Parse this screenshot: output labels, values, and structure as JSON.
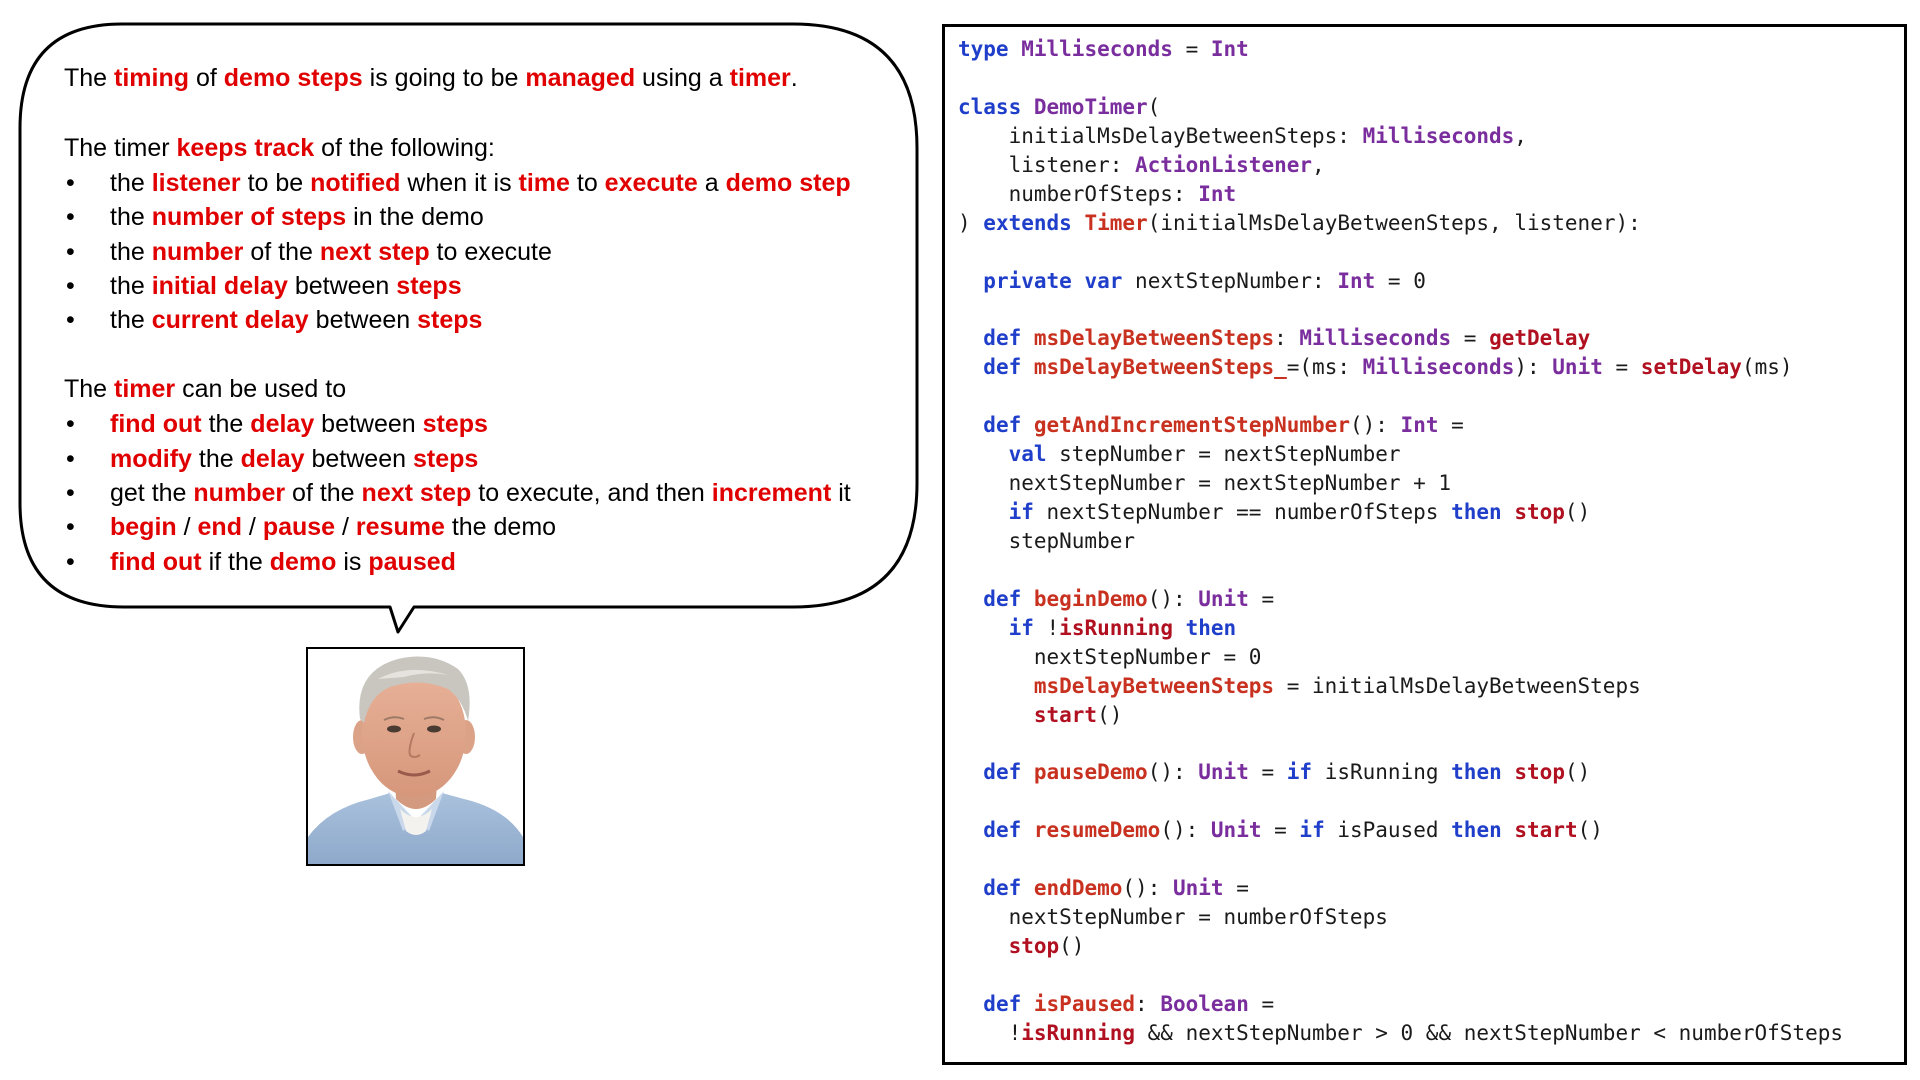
{
  "colors": {
    "highlight": "#e00000",
    "keyword": "#1f3ec9",
    "type": "#7a2e9e",
    "function": "#c8311f",
    "call": "#b01020",
    "text": "#000000"
  },
  "bubble": {
    "paragraphs": [
      {
        "kind": "line",
        "segments": [
          {
            "t": "The "
          },
          {
            "t": "timing",
            "h": true
          },
          {
            "t": " of "
          },
          {
            "t": "demo steps",
            "h": true
          },
          {
            "t": " is going to be "
          },
          {
            "t": "managed",
            "h": true
          },
          {
            "t": " using a "
          },
          {
            "t": "timer",
            "h": true
          },
          {
            "t": "."
          }
        ]
      },
      {
        "kind": "gap"
      },
      {
        "kind": "line",
        "segments": [
          {
            "t": "The timer "
          },
          {
            "t": "keeps track",
            "h": true
          },
          {
            "t": " of the following:"
          }
        ]
      },
      {
        "kind": "bullets",
        "items": [
          [
            {
              "t": "the "
            },
            {
              "t": "listener",
              "h": true
            },
            {
              "t": " to be "
            },
            {
              "t": "notified",
              "h": true
            },
            {
              "t": " when it is "
            },
            {
              "t": "time",
              "h": true
            },
            {
              "t": " to "
            },
            {
              "t": "execute",
              "h": true
            },
            {
              "t": " a "
            },
            {
              "t": "demo step",
              "h": true
            }
          ],
          [
            {
              "t": "the "
            },
            {
              "t": "number of steps",
              "h": true
            },
            {
              "t": " in the demo"
            }
          ],
          [
            {
              "t": "the "
            },
            {
              "t": "number",
              "h": true
            },
            {
              "t": " of the "
            },
            {
              "t": "next step",
              "h": true
            },
            {
              "t": " to execute"
            }
          ],
          [
            {
              "t": "the "
            },
            {
              "t": "initial delay",
              "h": true
            },
            {
              "t": " between "
            },
            {
              "t": "steps",
              "h": true
            }
          ],
          [
            {
              "t": "the "
            },
            {
              "t": "current delay",
              "h": true
            },
            {
              "t": " between "
            },
            {
              "t": "steps",
              "h": true
            }
          ]
        ]
      },
      {
        "kind": "gap"
      },
      {
        "kind": "line",
        "segments": [
          {
            "t": "The "
          },
          {
            "t": "timer",
            "h": true
          },
          {
            "t": " can be used to"
          }
        ]
      },
      {
        "kind": "bullets",
        "items": [
          [
            {
              "t": "find out",
              "h": true
            },
            {
              "t": " the "
            },
            {
              "t": "delay",
              "h": true
            },
            {
              "t": " between "
            },
            {
              "t": "steps",
              "h": true
            }
          ],
          [
            {
              "t": "modify",
              "h": true
            },
            {
              "t": " the "
            },
            {
              "t": "delay",
              "h": true
            },
            {
              "t": " between "
            },
            {
              "t": "steps",
              "h": true
            }
          ],
          [
            {
              "t": "get the "
            },
            {
              "t": "number",
              "h": true
            },
            {
              "t": " of the "
            },
            {
              "t": "next step",
              "h": true
            },
            {
              "t": " to execute, and then "
            },
            {
              "t": "increment",
              "h": true
            },
            {
              "t": " it"
            }
          ],
          [
            {
              "t": "begin",
              "h": true
            },
            {
              "t": " / "
            },
            {
              "t": "end",
              "h": true
            },
            {
              "t": " / "
            },
            {
              "t": "pause",
              "h": true
            },
            {
              "t": " / "
            },
            {
              "t": "resume",
              "h": true
            },
            {
              "t": " the demo"
            }
          ],
          [
            {
              "t": "find out",
              "h": true
            },
            {
              "t": " if the "
            },
            {
              "t": "demo",
              "h": true
            },
            {
              "t": " is "
            },
            {
              "t": "paused",
              "h": true
            }
          ]
        ]
      }
    ]
  },
  "code": [
    [
      [
        "kw",
        "type"
      ],
      [
        "p",
        " "
      ],
      [
        "ty",
        "Milliseconds"
      ],
      [
        "p",
        " = "
      ],
      [
        "ty",
        "Int"
      ]
    ],
    [],
    [
      [
        "kw",
        "class"
      ],
      [
        "p",
        " "
      ],
      [
        "ty",
        "DemoTimer"
      ],
      [
        "p",
        "("
      ]
    ],
    [
      [
        "p",
        "    initialMsDelayBetweenSteps: "
      ],
      [
        "ty",
        "Milliseconds"
      ],
      [
        "p",
        ","
      ]
    ],
    [
      [
        "p",
        "    listener: "
      ],
      [
        "ty",
        "ActionListener"
      ],
      [
        "p",
        ","
      ]
    ],
    [
      [
        "p",
        "    numberOfSteps: "
      ],
      [
        "ty",
        "Int"
      ]
    ],
    [
      [
        "p",
        ") "
      ],
      [
        "kw",
        "extends"
      ],
      [
        "p",
        " "
      ],
      [
        "fn",
        "Timer"
      ],
      [
        "p",
        "(initialMsDelayBetweenSteps, listener):"
      ]
    ],
    [],
    [
      [
        "p",
        "  "
      ],
      [
        "kw",
        "private"
      ],
      [
        "p",
        " "
      ],
      [
        "kw",
        "var"
      ],
      [
        "p",
        " nextStepNumber: "
      ],
      [
        "ty",
        "Int"
      ],
      [
        "p",
        " = 0"
      ]
    ],
    [],
    [
      [
        "p",
        "  "
      ],
      [
        "kw",
        "def"
      ],
      [
        "p",
        " "
      ],
      [
        "fn",
        "msDelayBetweenSteps"
      ],
      [
        "p",
        ": "
      ],
      [
        "ty",
        "Milliseconds"
      ],
      [
        "p",
        " = "
      ],
      [
        "call",
        "getDelay"
      ]
    ],
    [
      [
        "p",
        "  "
      ],
      [
        "kw",
        "def"
      ],
      [
        "p",
        " "
      ],
      [
        "fn",
        "msDelayBetweenSteps_"
      ],
      [
        "p",
        "=(ms: "
      ],
      [
        "ty",
        "Milliseconds"
      ],
      [
        "p",
        "): "
      ],
      [
        "ty",
        "Unit"
      ],
      [
        "p",
        " = "
      ],
      [
        "call",
        "setDelay"
      ],
      [
        "p",
        "(ms)"
      ]
    ],
    [],
    [
      [
        "p",
        "  "
      ],
      [
        "kw",
        "def"
      ],
      [
        "p",
        " "
      ],
      [
        "fn",
        "getAndIncrementStepNumber"
      ],
      [
        "p",
        "(): "
      ],
      [
        "ty",
        "Int"
      ],
      [
        "p",
        " ="
      ]
    ],
    [
      [
        "p",
        "    "
      ],
      [
        "kw",
        "val"
      ],
      [
        "p",
        " stepNumber = nextStepNumber"
      ]
    ],
    [
      [
        "p",
        "    nextStepNumber = nextStepNumber + 1"
      ]
    ],
    [
      [
        "p",
        "    "
      ],
      [
        "kw",
        "if"
      ],
      [
        "p",
        " nextStepNumber == numberOfSteps "
      ],
      [
        "kw",
        "then"
      ],
      [
        "p",
        " "
      ],
      [
        "call",
        "stop"
      ],
      [
        "p",
        "()"
      ]
    ],
    [
      [
        "p",
        "    stepNumber"
      ]
    ],
    [],
    [
      [
        "p",
        "  "
      ],
      [
        "kw",
        "def"
      ],
      [
        "p",
        " "
      ],
      [
        "fn",
        "beginDemo"
      ],
      [
        "p",
        "(): "
      ],
      [
        "ty",
        "Unit"
      ],
      [
        "p",
        " ="
      ]
    ],
    [
      [
        "p",
        "    "
      ],
      [
        "kw",
        "if"
      ],
      [
        "p",
        " !"
      ],
      [
        "call",
        "isRunning"
      ],
      [
        "p",
        " "
      ],
      [
        "kw",
        "then"
      ]
    ],
    [
      [
        "p",
        "      nextStepNumber = 0"
      ]
    ],
    [
      [
        "p",
        "      "
      ],
      [
        "fn",
        "msDelayBetweenSteps"
      ],
      [
        "p",
        " = initialMsDelayBetweenSteps"
      ]
    ],
    [
      [
        "p",
        "      "
      ],
      [
        "call",
        "start"
      ],
      [
        "p",
        "()"
      ]
    ],
    [],
    [
      [
        "p",
        "  "
      ],
      [
        "kw",
        "def"
      ],
      [
        "p",
        " "
      ],
      [
        "fn",
        "pauseDemo"
      ],
      [
        "p",
        "(): "
      ],
      [
        "ty",
        "Unit"
      ],
      [
        "p",
        " = "
      ],
      [
        "kw",
        "if"
      ],
      [
        "p",
        " isRunning "
      ],
      [
        "kw",
        "then"
      ],
      [
        "p",
        " "
      ],
      [
        "call",
        "stop"
      ],
      [
        "p",
        "()"
      ]
    ],
    [],
    [
      [
        "p",
        "  "
      ],
      [
        "kw",
        "def"
      ],
      [
        "p",
        " "
      ],
      [
        "fn",
        "resumeDemo"
      ],
      [
        "p",
        "(): "
      ],
      [
        "ty",
        "Unit"
      ],
      [
        "p",
        " = "
      ],
      [
        "kw",
        "if"
      ],
      [
        "p",
        " isPaused "
      ],
      [
        "kw",
        "then"
      ],
      [
        "p",
        " "
      ],
      [
        "call",
        "start"
      ],
      [
        "p",
        "()"
      ]
    ],
    [],
    [
      [
        "p",
        "  "
      ],
      [
        "kw",
        "def"
      ],
      [
        "p",
        " "
      ],
      [
        "fn",
        "endDemo"
      ],
      [
        "p",
        "(): "
      ],
      [
        "ty",
        "Unit"
      ],
      [
        "p",
        " ="
      ]
    ],
    [
      [
        "p",
        "    nextStepNumber = numberOfSteps"
      ]
    ],
    [
      [
        "p",
        "    "
      ],
      [
        "call",
        "stop"
      ],
      [
        "p",
        "()"
      ]
    ],
    [],
    [
      [
        "p",
        "  "
      ],
      [
        "kw",
        "def"
      ],
      [
        "p",
        " "
      ],
      [
        "fn",
        "isPaused"
      ],
      [
        "p",
        ": "
      ],
      [
        "ty",
        "Boolean"
      ],
      [
        "p",
        " ="
      ]
    ],
    [
      [
        "p",
        "    !"
      ],
      [
        "call",
        "isRunning"
      ],
      [
        "p",
        " && nextStepNumber > 0 && nextStepNumber < numberOfSteps"
      ]
    ]
  ]
}
